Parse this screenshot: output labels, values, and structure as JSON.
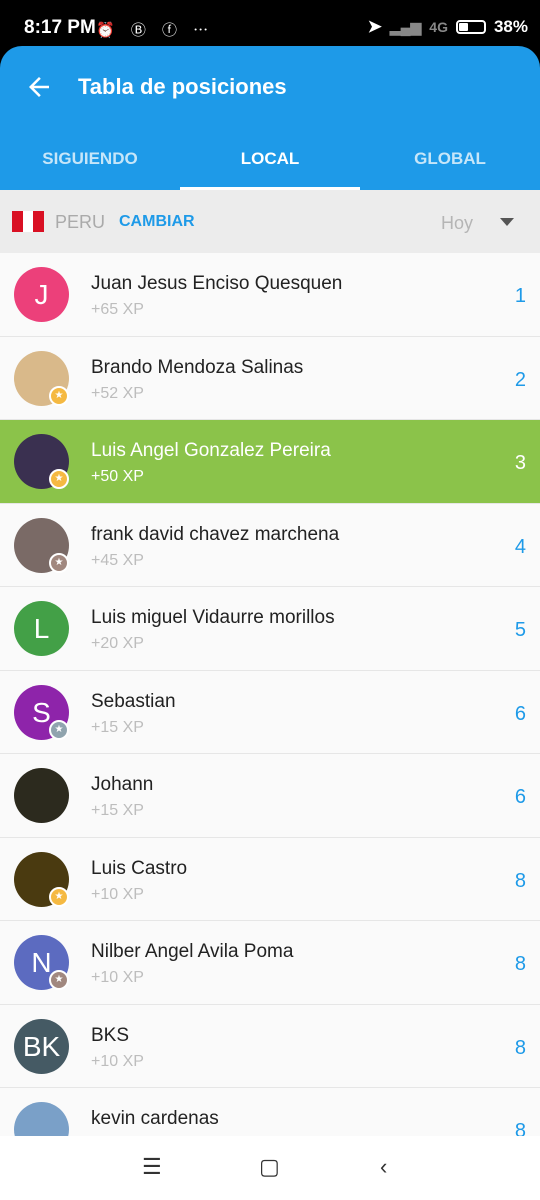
{
  "status": {
    "time": "8:17 PM",
    "network": "4G",
    "battery": "38%"
  },
  "header": {
    "title": "Tabla de posiciones"
  },
  "tabs": [
    {
      "label": "SIGUIENDO",
      "active": false
    },
    {
      "label": "LOCAL",
      "active": true
    },
    {
      "label": "GLOBAL",
      "active": false
    }
  ],
  "filter": {
    "country": "PERU",
    "change_label": "CAMBIAR",
    "period": "Hoy"
  },
  "accent": "#1e9ae8",
  "highlight": "#8bc34a",
  "rows": [
    {
      "initial": "J",
      "avatar_color": "#ec407a",
      "badge": "",
      "name": "Juan Jesus Enciso Quesquen",
      "xp": "+65 XP",
      "rank": "1"
    },
    {
      "initial": "",
      "avatar_color": "#d9b98a",
      "badge": "gold",
      "name": "Brando Mendoza Salinas",
      "xp": "+52 XP",
      "rank": "2"
    },
    {
      "initial": "",
      "avatar_color": "#3a3050",
      "badge": "gold",
      "name": "Luis Angel Gonzalez Pereira",
      "xp": "+50 XP",
      "rank": "3",
      "highlight": true
    },
    {
      "initial": "",
      "avatar_color": "#7a6a66",
      "badge": "bronze",
      "name": "frank david chavez marchena",
      "xp": "+45 XP",
      "rank": "4"
    },
    {
      "initial": "L",
      "avatar_color": "#43a047",
      "badge": "",
      "name": "Luis miguel Vidaurre morillos",
      "xp": "+20 XP",
      "rank": "5"
    },
    {
      "initial": "S",
      "avatar_color": "#8e24aa",
      "badge": "silver",
      "name": "Sebastian",
      "xp": "+15 XP",
      "rank": "6"
    },
    {
      "initial": "",
      "avatar_color": "#2c2a1e",
      "badge": "",
      "name": "Johann",
      "xp": "+15 XP",
      "rank": "6"
    },
    {
      "initial": "",
      "avatar_color": "#4a3a10",
      "badge": "gold",
      "name": "Luis Castro",
      "xp": "+10 XP",
      "rank": "8"
    },
    {
      "initial": "N",
      "avatar_color": "#5c6bc0",
      "badge": "bronze",
      "name": "Nilber Angel Avila Poma",
      "xp": "+10 XP",
      "rank": "8"
    },
    {
      "initial": "BK",
      "avatar_color": "#455a64",
      "badge": "",
      "name": "BKS",
      "xp": "+10 XP",
      "rank": "8"
    },
    {
      "initial": "",
      "avatar_color": "#7aa0c8",
      "badge": "",
      "name": "kevin cardenas",
      "xp": "",
      "rank": "8"
    }
  ],
  "badge_colors": {
    "gold": "#f5b942",
    "silver": "#90a4ae",
    "bronze": "#a1887f"
  }
}
